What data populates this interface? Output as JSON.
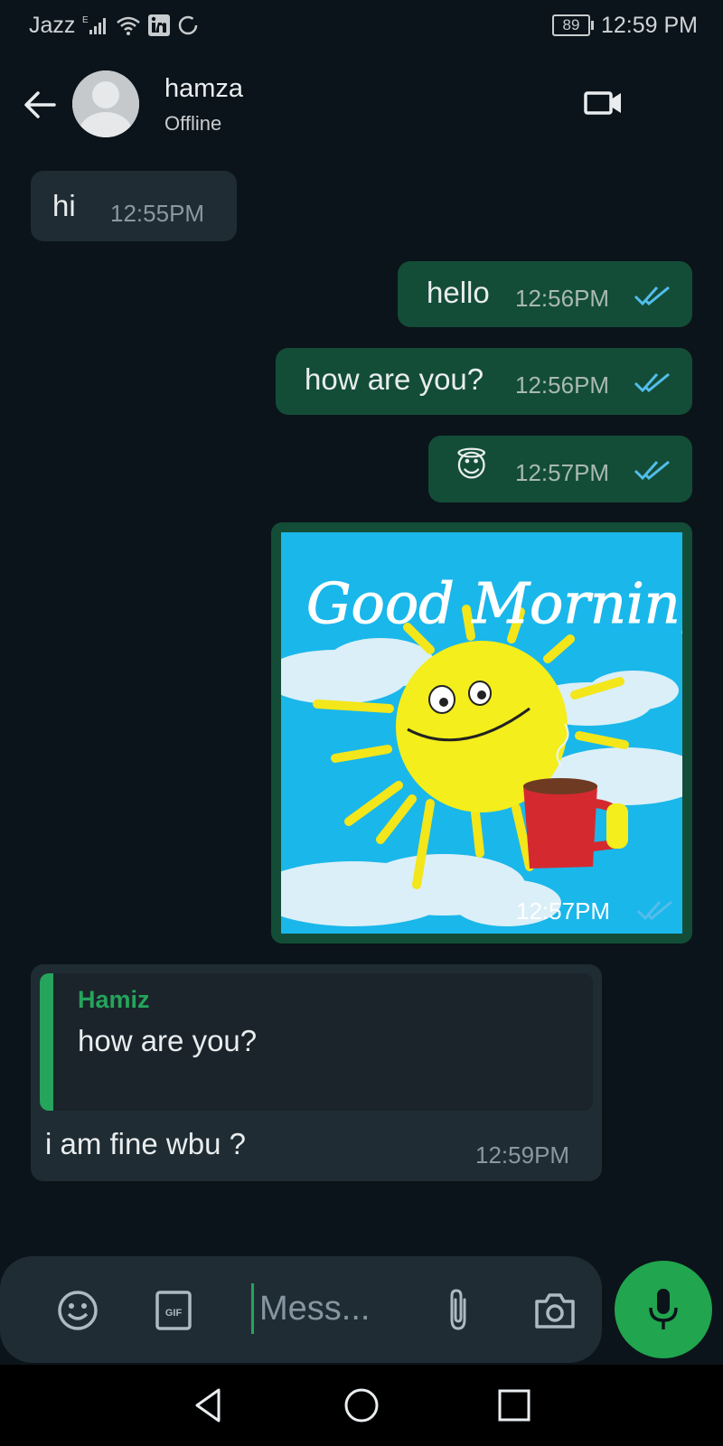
{
  "status_bar": {
    "carrier": "Jazz",
    "network_type": "E",
    "battery_level": "89",
    "time": "12:59 PM",
    "icons": [
      "signal-icon",
      "wifi-icon",
      "linkedin-icon",
      "sync-icon",
      "battery-icon"
    ]
  },
  "header": {
    "contact_name": "hamza",
    "contact_status": "Offline",
    "icons": [
      "back-arrow-icon",
      "avatar",
      "video-call-icon"
    ]
  },
  "messages": [
    {
      "direction": "incoming",
      "text": "hi",
      "time": "12:55PM"
    },
    {
      "direction": "outgoing",
      "text": "hello",
      "time": "12:56PM",
      "read": true
    },
    {
      "direction": "outgoing",
      "text": "how are you?",
      "time": "12:56PM",
      "read": true
    },
    {
      "direction": "outgoing",
      "text": "😇",
      "time": "12:57PM",
      "read": true
    },
    {
      "direction": "outgoing",
      "type": "image",
      "image_text": "Good Morning",
      "time": "12:57PM",
      "read": true
    },
    {
      "direction": "incoming",
      "reply_to": {
        "author": "Hamiz",
        "text": "how are you?"
      },
      "text": "i am fine wbu ?",
      "time": "12:59PM"
    }
  ],
  "input": {
    "placeholder": "Mess...",
    "icons": [
      "emoji-icon",
      "gif-icon",
      "attach-icon",
      "camera-icon",
      "mic-icon"
    ]
  },
  "nav": {
    "icons": [
      "nav-back-icon",
      "nav-home-icon",
      "nav-recents-icon"
    ]
  },
  "colors": {
    "background": "#0b141a",
    "incoming_bubble": "#1f2c33",
    "outgoing_bubble": "#134d37",
    "accent_green": "#21a54f",
    "read_tick_blue": "#53bdeb"
  }
}
